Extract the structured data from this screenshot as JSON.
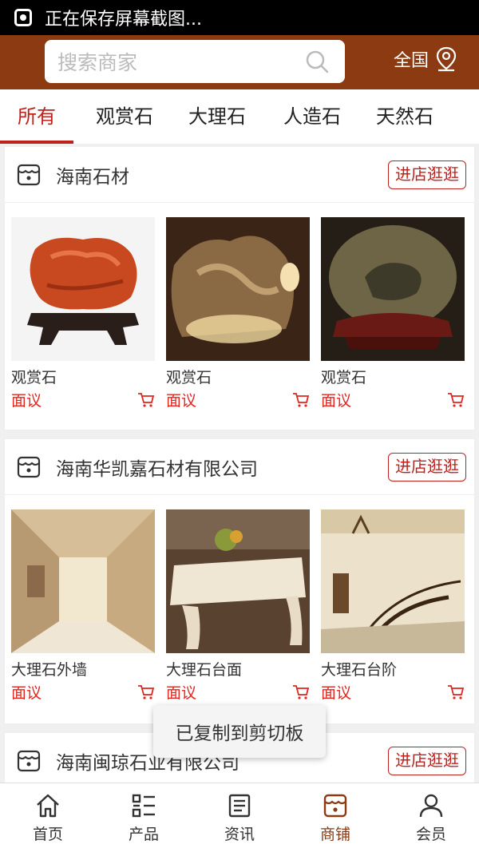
{
  "status_bar": {
    "text": "正在保存屏幕截图..."
  },
  "header": {
    "search_placeholder": "搜索商家",
    "region": "全国"
  },
  "tabs": [
    {
      "label": "所有",
      "active": true
    },
    {
      "label": "观赏石",
      "active": false
    },
    {
      "label": "大理石",
      "active": false
    },
    {
      "label": "人造石",
      "active": false
    },
    {
      "label": "天然石",
      "active": false
    }
  ],
  "shops": [
    {
      "name": "海南石材",
      "visit_label": "进店逛逛",
      "products": [
        {
          "name": "观赏石",
          "price": "面议"
        },
        {
          "name": "观赏石",
          "price": "面议"
        },
        {
          "name": "观赏石",
          "price": "面议"
        }
      ]
    },
    {
      "name": "海南华凯嘉石材有限公司",
      "visit_label": "进店逛逛",
      "products": [
        {
          "name": "大理石外墙",
          "price": "面议"
        },
        {
          "name": "大理石台面",
          "price": "面议"
        },
        {
          "name": "大理石台阶",
          "price": "面议"
        }
      ]
    },
    {
      "name": "海南闽琼石业有限公司",
      "visit_label": "进店逛逛",
      "products": []
    }
  ],
  "toast": "已复制到剪切板",
  "bottom_nav": [
    {
      "label": "首页",
      "icon": "home-icon",
      "active": false
    },
    {
      "label": "产品",
      "icon": "grid-list-icon",
      "active": false
    },
    {
      "label": "资讯",
      "icon": "news-icon",
      "active": false
    },
    {
      "label": "商铺",
      "icon": "shop-icon",
      "active": true
    },
    {
      "label": "会员",
      "icon": "user-icon",
      "active": false
    }
  ],
  "colors": {
    "header": "#8b3a12",
    "accent": "#c0201c",
    "price": "#e0261f"
  }
}
